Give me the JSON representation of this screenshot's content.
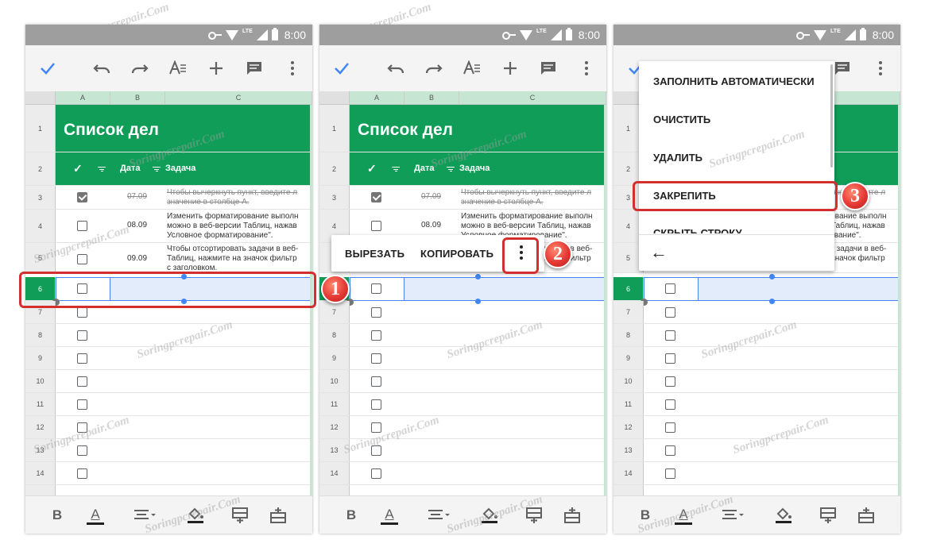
{
  "status": {
    "time": "8:00",
    "network": "LTE"
  },
  "sheet": {
    "columns": [
      "A",
      "B",
      "C"
    ],
    "rows": [
      "1",
      "2",
      "3",
      "4",
      "5",
      "6",
      "7",
      "8",
      "9",
      "10",
      "11",
      "12",
      "13",
      "14"
    ],
    "title": "Список дел",
    "header": {
      "check": "✓",
      "date": "Дата",
      "task": "Задача"
    },
    "row3": {
      "date": "07.09",
      "line1": "Чтобы вычеркнуть пункт, введите л",
      "line2": "значение в столбце А."
    },
    "row4": {
      "date": "08.09",
      "line1": "Изменить форматирование выполн",
      "line2": "можно в веб-версии Таблиц, нажав",
      "line3": "Условное форматирование\"."
    },
    "row5": {
      "date": "09.09",
      "line1": "Чтобы отсортировать задачи в веб-",
      "line2": "Таблиц, нажмите на значок фильтр",
      "line3": "с заголовком."
    }
  },
  "popup": {
    "cut": "ВЫРЕЗАТЬ",
    "copy": "КОПИРОВАТЬ"
  },
  "menu": {
    "items": [
      "ЗАПОЛНИТЬ АВТОМАТИЧЕСКИ",
      "ОЧИСТИТЬ",
      "УДАЛИТЬ",
      "ЗАКРЕПИТЬ",
      "СКРЫТЬ СТРОКУ"
    ],
    "back": "←"
  },
  "steps": [
    "1",
    "2",
    "3"
  ],
  "bottombar": {
    "bold": "B",
    "text_color": "A"
  },
  "watermark": "Soringpcrepair.Com",
  "colors": {
    "green": "#0f9d58",
    "accent": "#4285f4",
    "marker": "#e53935"
  }
}
